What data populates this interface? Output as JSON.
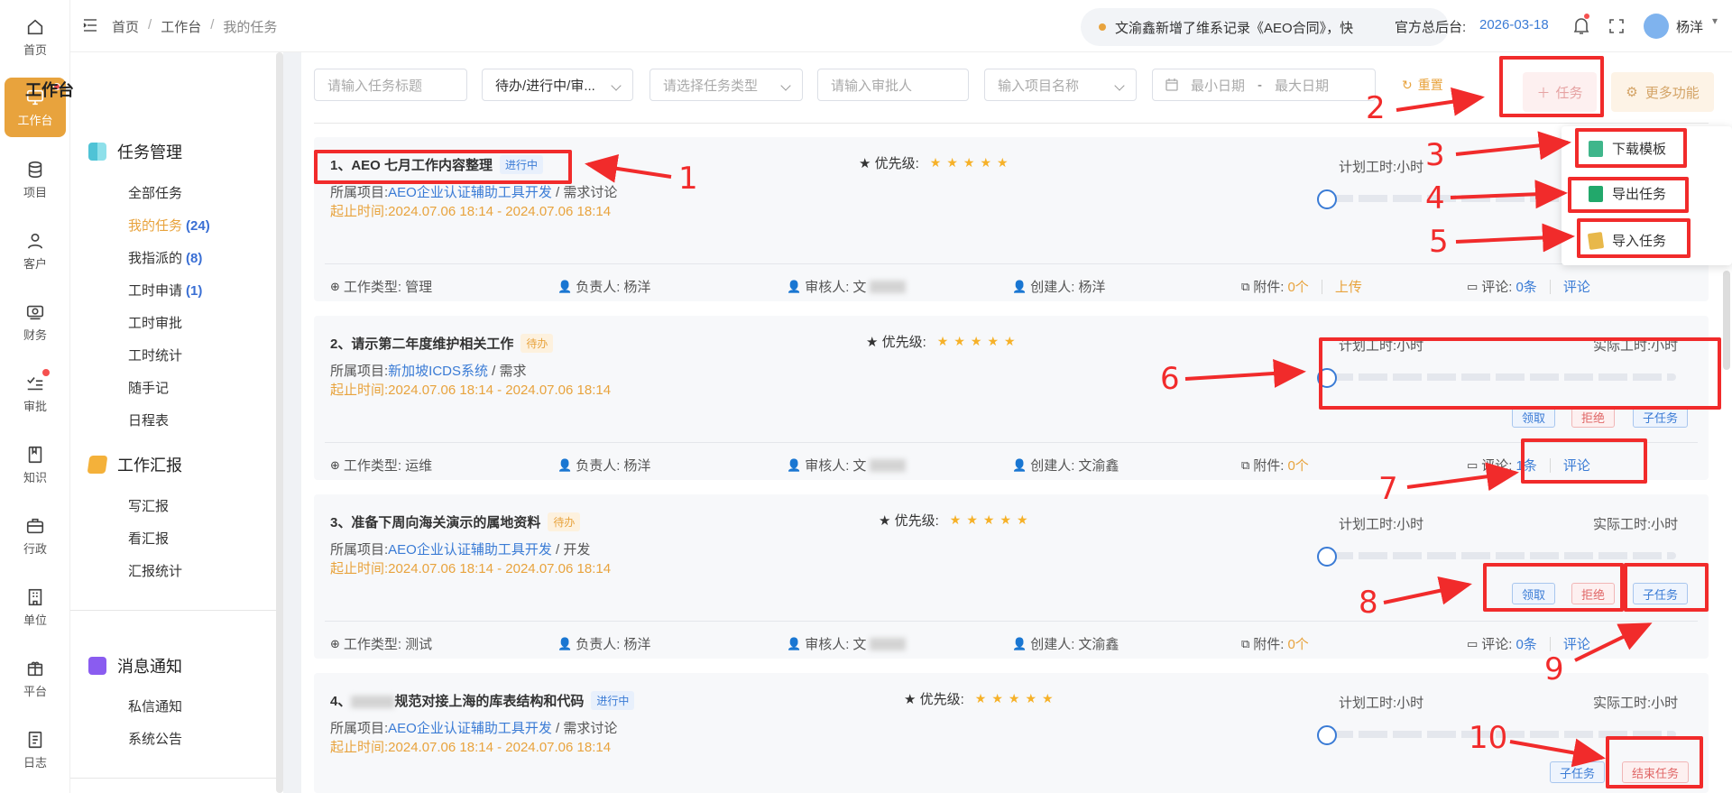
{
  "rail": [
    {
      "label": "首页",
      "icon": "home-icon"
    },
    {
      "label": "工作台",
      "icon": "monitor-icon"
    },
    {
      "label": "项目",
      "icon": "database-icon"
    },
    {
      "label": "客户",
      "icon": "user-icon"
    },
    {
      "label": "财务",
      "icon": "wallet-icon"
    },
    {
      "label": "审批",
      "icon": "checklist-icon"
    },
    {
      "label": "知识",
      "icon": "book-icon"
    },
    {
      "label": "行政",
      "icon": "briefcase-icon"
    },
    {
      "label": "单位",
      "icon": "building-icon"
    },
    {
      "label": "平台",
      "icon": "package-icon"
    },
    {
      "label": "日志",
      "icon": "log-icon"
    }
  ],
  "breadcrumb": {
    "home": "首页",
    "sep": "/",
    "workbench": "工作台",
    "current": "我的任务"
  },
  "notice": "文渝鑫新增了维系记录《AEO合同》，快",
  "official": {
    "label": "官方总后台:",
    "date": "2026-03-18"
  },
  "user": {
    "name": "杨洋"
  },
  "sidebar": {
    "title": "工作台",
    "task_group": "任务管理",
    "task_items": [
      {
        "label": "全部任务",
        "count": ""
      },
      {
        "label": "我的任务",
        "count": "(24)"
      },
      {
        "label": "我指派的",
        "count": "(8)"
      },
      {
        "label": "工时申请",
        "count": "(1)"
      },
      {
        "label": "工时审批",
        "count": ""
      },
      {
        "label": "工时统计",
        "count": ""
      },
      {
        "label": "随手记",
        "count": ""
      },
      {
        "label": "日程表",
        "count": ""
      }
    ],
    "report_group": "工作汇报",
    "report_items": [
      "写汇报",
      "看汇报",
      "汇报统计"
    ],
    "msg_group": "消息通知",
    "msg_items": [
      "私信通知",
      "系统公告"
    ]
  },
  "filters": {
    "title_ph": "请输入任务标题",
    "status": "待办/进行中/审...",
    "type_ph": "请选择任务类型",
    "approver_ph": "请输入审批人",
    "project_ph": "输入项目名称",
    "date_min": "最小日期",
    "date_dash": "-",
    "date_max": "最大日期",
    "reset": "重置",
    "add_task": "任务",
    "more": "更多功能"
  },
  "dropdown": {
    "download": "下载模板",
    "export": "导出任务",
    "import": "导入任务"
  },
  "labels": {
    "priority": "优先级:",
    "project": "所属项目:",
    "period": "起止时间:",
    "plan_hours": "计划工时:",
    "actual_hours": "实际工时:",
    "hours_unit": "小时",
    "work_type": "工作类型:",
    "owner": "负责人:",
    "reviewer": "审核人:",
    "creator": "创建人:",
    "attach": "附件:",
    "upload": "上传",
    "comment": "评论:",
    "comment_link": "评论",
    "claim": "领取",
    "reject": "拒绝",
    "subtask": "子任务",
    "end_task": "结束任务"
  },
  "tasks": [
    {
      "title": "1、AEO 七月工作内容整理",
      "status": "进行中",
      "project": "AEO企业认证辅助工具开发",
      "project_sub": " / 需求讨论",
      "period": "2024.07.06 18:14 - 2024.07.06 18:14",
      "stars": "★★★★★",
      "type": "管理",
      "owner": "杨洋",
      "reviewer": "文",
      "creator": "杨洋",
      "attach": "0个",
      "comment": "0条"
    },
    {
      "title": "2、请示第二年度维护相关工作",
      "status": "待办",
      "project": "新加坡ICDS系统",
      "project_sub": " / 需求",
      "period": "2024.07.06 18:14 - 2024.07.06 18:14",
      "stars": "★★★★★",
      "type": "运维",
      "owner": "杨洋",
      "reviewer": "文",
      "creator": "文渝鑫",
      "attach": "0个",
      "comment": "1条"
    },
    {
      "title": "3、准备下周向海关演示的属地资料",
      "status": "待办",
      "project": "AEO企业认证辅助工具开发",
      "project_sub": " / 开发",
      "period": "2024.07.06 18:14 - 2024.07.06 18:14",
      "stars": "★★★★★",
      "type": "测试",
      "owner": "杨洋",
      "reviewer": "文",
      "creator": "文渝鑫",
      "attach": "0个",
      "comment": "0条"
    },
    {
      "title_prefix": "4、",
      "title": "规范对接上海的库表结构和代码",
      "status": "进行中",
      "project": "AEO企业认证辅助工具开发",
      "project_sub": " / 需求讨论",
      "period": "2024.07.06 18:14 - 2024.07.06 18:14",
      "stars": "★★★★★"
    }
  ],
  "annotations": [
    "1",
    "2",
    "3",
    "4",
    "5",
    "6",
    "7",
    "8",
    "9",
    "10"
  ],
  "colors": {
    "accent": "#e8a33d",
    "link": "#3a7bd5",
    "annotation": "#f12b2b"
  }
}
